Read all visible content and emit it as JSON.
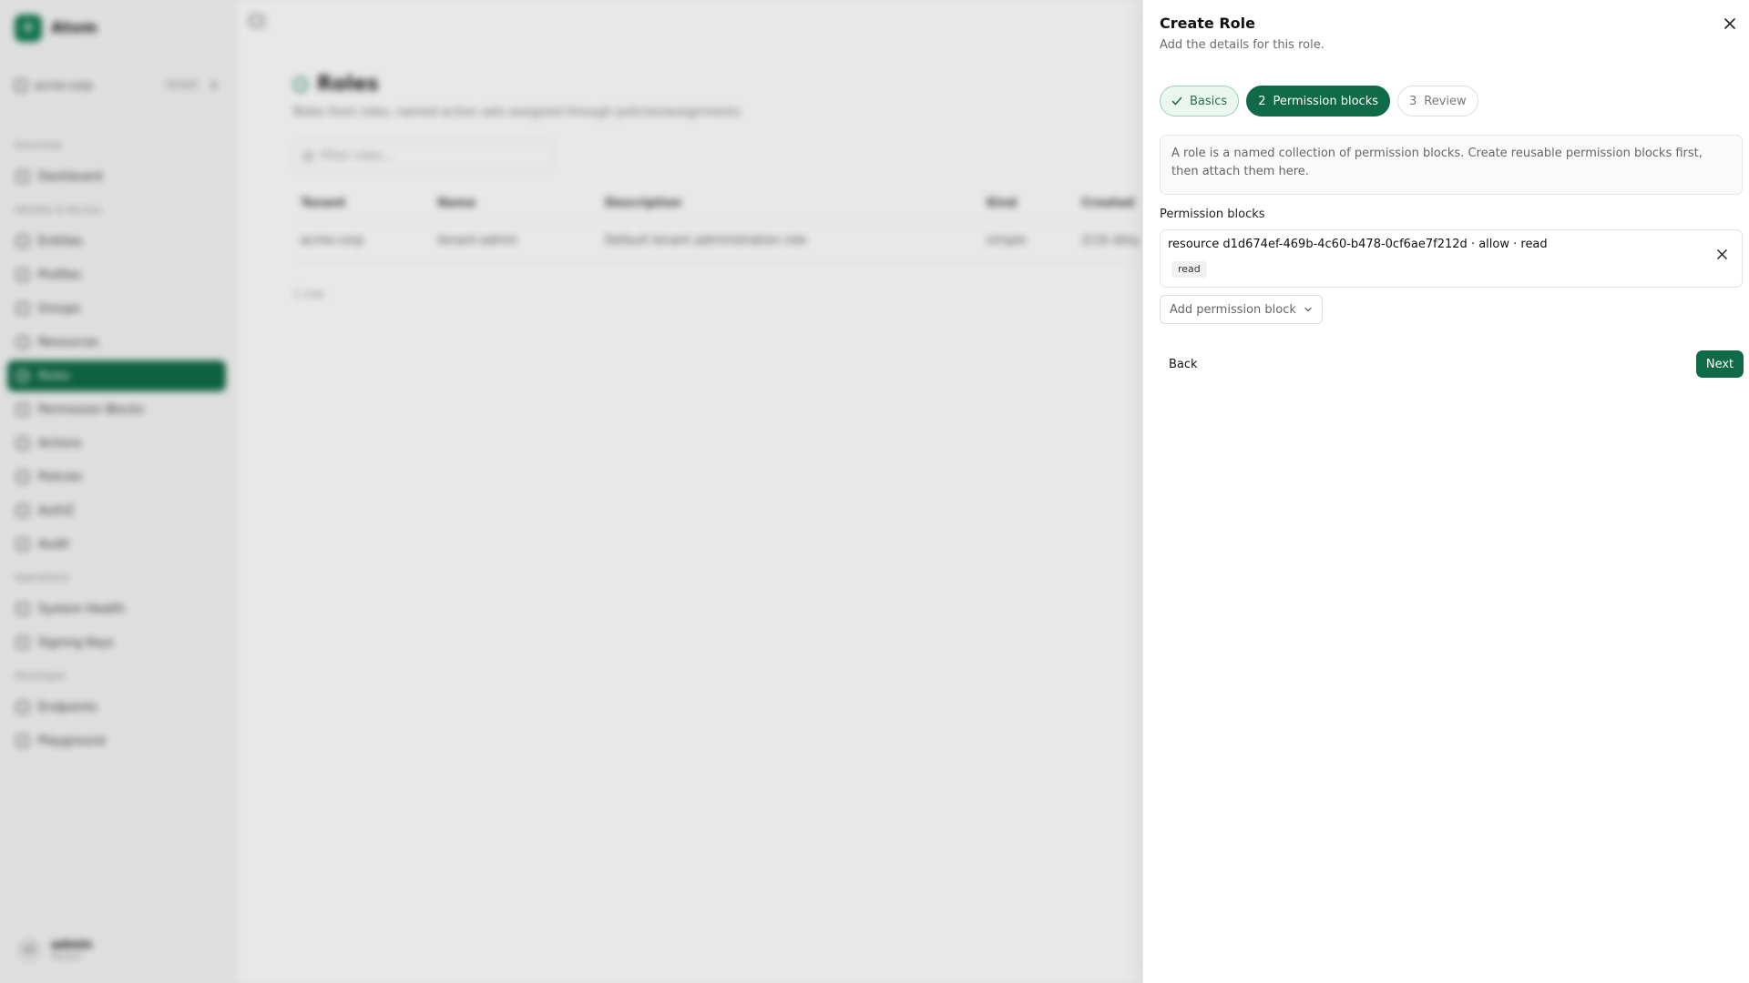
{
  "app": {
    "brand_initial": "O",
    "brand_name": "Atom",
    "tenant": {
      "name": "acme-corp",
      "badge": "tenant"
    },
    "nav": [
      {
        "type": "section",
        "label": "Overview"
      },
      {
        "type": "item",
        "label": "Dashboard",
        "icon": "home-icon"
      },
      {
        "type": "section",
        "label": "Identity & Access"
      },
      {
        "type": "item",
        "label": "Entities",
        "icon": "entities-icon"
      },
      {
        "type": "item",
        "label": "Profiles",
        "icon": "profiles-icon"
      },
      {
        "type": "item",
        "label": "Groups",
        "icon": "groups-icon"
      },
      {
        "type": "item",
        "label": "Resources",
        "icon": "resources-icon"
      },
      {
        "type": "item",
        "label": "Roles",
        "icon": "roles-icon",
        "active": true
      },
      {
        "type": "item",
        "label": "Permission Blocks",
        "icon": "lock-icon"
      },
      {
        "type": "item",
        "label": "Actions",
        "icon": "actions-icon"
      },
      {
        "type": "item",
        "label": "Policies",
        "icon": "policies-icon"
      },
      {
        "type": "item",
        "label": "AuthZ",
        "icon": "authz-icon"
      },
      {
        "type": "item",
        "label": "Audit",
        "icon": "audit-icon"
      },
      {
        "type": "section",
        "label": "Operations"
      },
      {
        "type": "item",
        "label": "System Health",
        "icon": "health-icon"
      },
      {
        "type": "item",
        "label": "Signing Keys",
        "icon": "key-icon"
      },
      {
        "type": "section",
        "label": "Developer"
      },
      {
        "type": "item",
        "label": "Endpoints",
        "icon": "endpoints-icon"
      },
      {
        "type": "item",
        "label": "Playground",
        "icon": "playground-icon"
      }
    ],
    "user": {
      "initials": "AD",
      "name": "admin",
      "role": "Tenant"
    },
    "page": {
      "title": "Roles",
      "subtitle": "Roles from roles, named action sets assigned through policies/assignments.",
      "filter_placeholder": "Filter roles...",
      "columns": [
        "Tenant",
        "Name",
        "Description",
        "Kind",
        "Created"
      ],
      "rows": [
        [
          "acme-corp",
          "tenant-admin",
          "Default tenant administration role",
          "simple",
          "2(16 ditsç"
        ]
      ],
      "row_count": "1 row"
    }
  },
  "sheet": {
    "title": "Create Role",
    "description": "Add the details for this role.",
    "steps": [
      {
        "label": "Basics",
        "state": "done"
      },
      {
        "number": "2",
        "label": "Permission blocks",
        "state": "active"
      },
      {
        "number": "3",
        "label": "Review",
        "state": "todo"
      }
    ],
    "info": "A role is a named collection of permission blocks. Create reusable permission blocks first, then attach them here.",
    "section_label": "Permission blocks",
    "blocks": [
      {
        "title": "resource d1d674ef-469b-4c60-b478-0cf6ae7f212d · allow · read",
        "action": "read"
      }
    ],
    "add_label": "Add permission block",
    "back_label": "Back",
    "next_label": "Next"
  },
  "colors": {
    "accent": "#0f6b47",
    "done_bg": "#eaf6f0",
    "done_border": "#9fcfb8"
  }
}
